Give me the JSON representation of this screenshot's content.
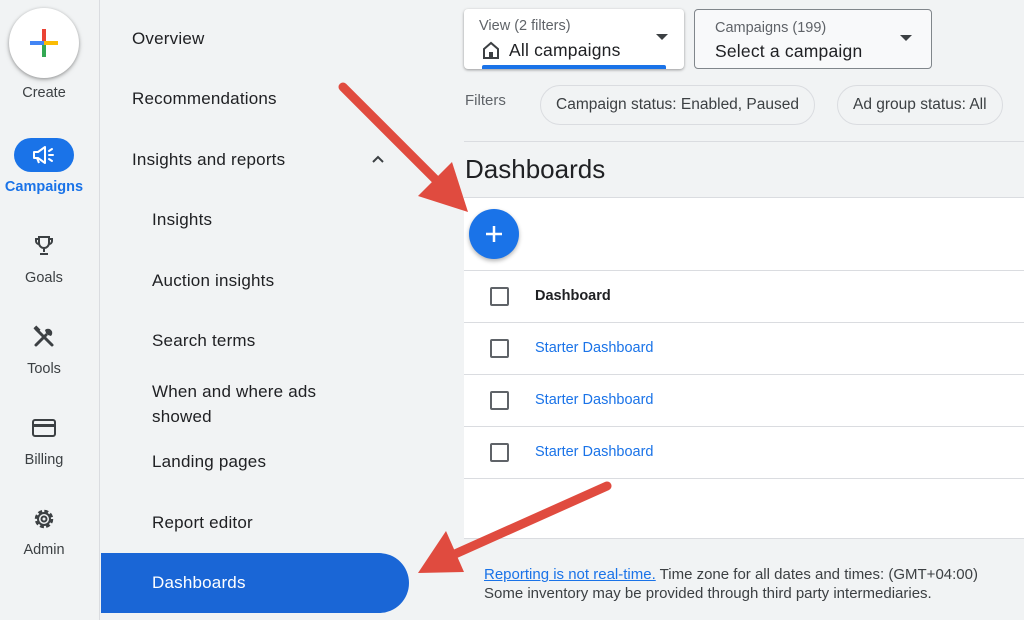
{
  "rail": {
    "items": [
      {
        "label": "Create"
      },
      {
        "label": "Campaigns"
      },
      {
        "label": "Goals"
      },
      {
        "label": "Tools"
      },
      {
        "label": "Billing"
      },
      {
        "label": "Admin"
      }
    ]
  },
  "nav": {
    "items": [
      {
        "label": "Overview"
      },
      {
        "label": "Recommendations"
      },
      {
        "label": "Insights and reports"
      },
      {
        "label": "Insights"
      },
      {
        "label": "Auction insights"
      },
      {
        "label": "Search terms"
      },
      {
        "label": "When and where ads showed"
      },
      {
        "label": "Landing pages"
      },
      {
        "label": "Report editor"
      },
      {
        "label": "Dashboards"
      }
    ]
  },
  "view_dropdown": {
    "caption": "View (2 filters)",
    "value": "All campaigns"
  },
  "campaign_dropdown": {
    "caption": "Campaigns (199)",
    "value": "Select a campaign"
  },
  "filters": {
    "label": "Filters",
    "chips": [
      "Campaign status: Enabled, Paused",
      "Ad group status: All"
    ]
  },
  "page_title": "Dashboards",
  "table": {
    "header": "Dashboard",
    "rows": [
      "Starter Dashboard",
      "Starter Dashboard",
      "Starter Dashboard"
    ]
  },
  "footer": {
    "link": "Reporting is not real-time.",
    "line1_rest": " Time zone for all dates and times: (GMT+04:00)",
    "line2": "Some inventory may be provided through third party intermediaries."
  },
  "colors": {
    "accent": "#1a73e8",
    "annotation_arrow": "#e04b3f"
  },
  "icons": {
    "create": "plus-multicolor-icon",
    "campaigns": "megaphone-icon",
    "goals": "trophy-icon",
    "tools": "tools-icon",
    "billing": "credit-card-icon",
    "admin": "gear-icon",
    "view": "home-icon",
    "add": "plus-icon",
    "expand": "chevron-up-icon"
  }
}
